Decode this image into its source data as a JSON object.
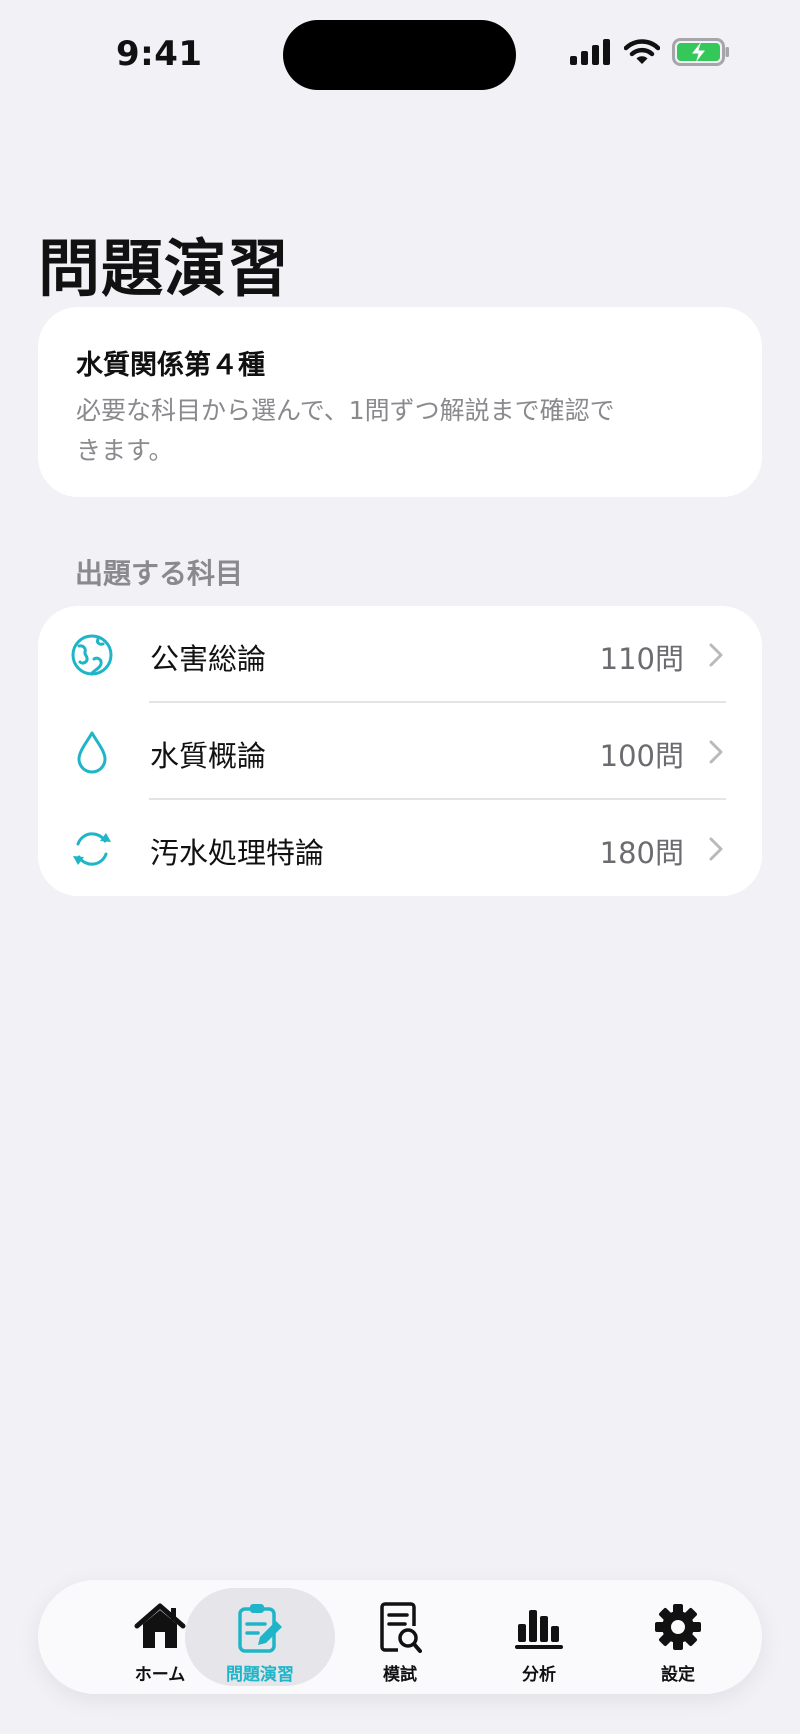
{
  "status_bar": {
    "time": "9:41"
  },
  "page": {
    "title": "問題演習"
  },
  "intro": {
    "title": "水質関係第４種",
    "description": "必要な科目から選んで、1問ずつ解説まで確認できます。"
  },
  "subjects_section": {
    "label": "出題する科目"
  },
  "subjects": [
    {
      "name": "公害総論",
      "count": "110問",
      "icon": "globe-icon"
    },
    {
      "name": "水質概論",
      "count": "100問",
      "icon": "water-drop-icon"
    },
    {
      "name": "汚水処理特論",
      "count": "180問",
      "icon": "recycle-arrows-icon"
    }
  ],
  "tab_bar": {
    "active": "問題演習",
    "items": [
      {
        "label": "ホーム",
        "icon": "home-icon"
      },
      {
        "label": "問題演習",
        "icon": "clipboard-edit-icon"
      },
      {
        "label": "模試",
        "icon": "document-search-icon"
      },
      {
        "label": "分析",
        "icon": "bar-chart-icon"
      },
      {
        "label": "設定",
        "icon": "gear-icon"
      }
    ]
  },
  "colors": {
    "accent": "#1fb5c8",
    "background": "#f1f1f6",
    "card": "#ffffff",
    "secondary_text": "#8a8a8e",
    "battery_green": "#34c759"
  }
}
